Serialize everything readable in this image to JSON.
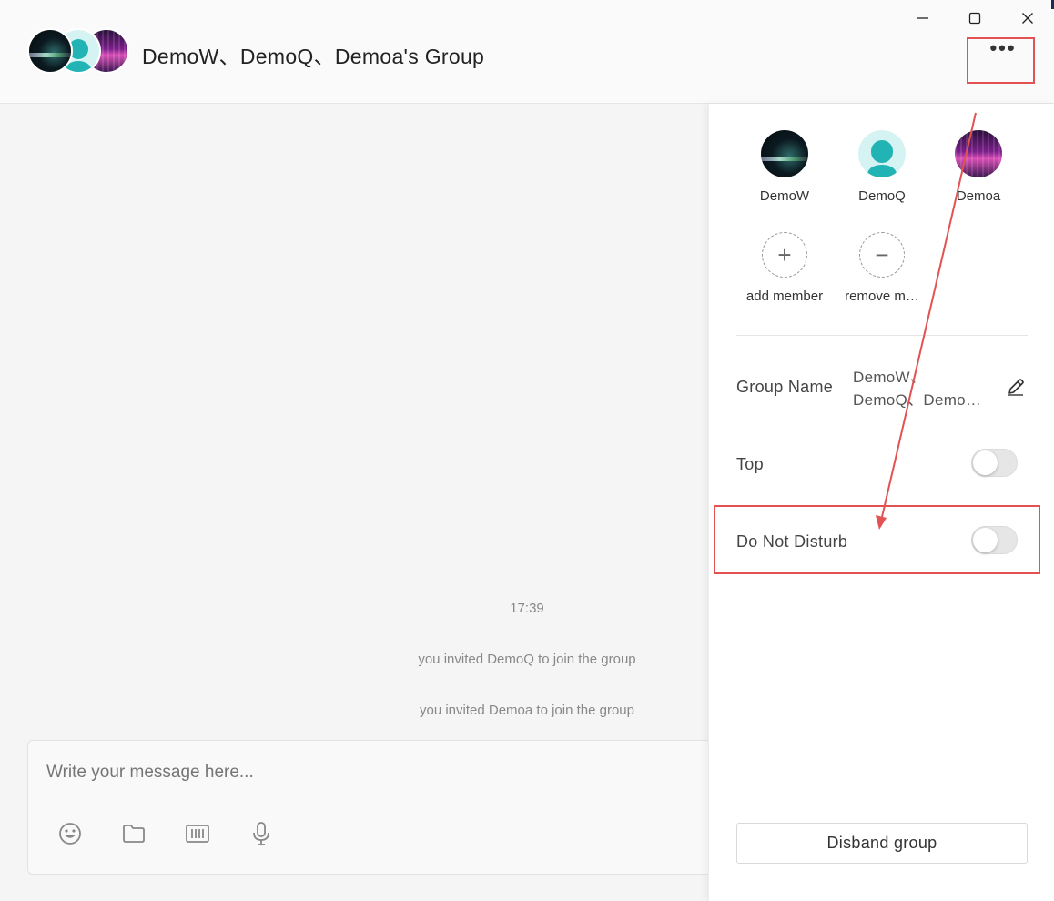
{
  "window": {
    "minimize": "—",
    "maximize": "☐",
    "close": "✕"
  },
  "header": {
    "title": "DemoW、DemoQ、Demoa's Group",
    "more_label": "•••",
    "avatars": [
      "DemoW-avatar",
      "DemoQ-avatar",
      "Demoa-avatar"
    ]
  },
  "chat": {
    "timestamp": "17:39",
    "system_messages": [
      "you invited DemoQ to join the group",
      "you invited Demoa to join the group"
    ]
  },
  "composer": {
    "placeholder": "Write your message here...",
    "tools": [
      "emoji-icon",
      "folder-icon",
      "screenshot-icon",
      "microphone-icon"
    ]
  },
  "panel": {
    "members": [
      {
        "name": "DemoW"
      },
      {
        "name": "DemoQ"
      },
      {
        "name": "Demoa"
      }
    ],
    "add_member": {
      "label": "add member",
      "symbol": "+"
    },
    "remove_member": {
      "label": "remove m…",
      "symbol": "−"
    },
    "group_name": {
      "label": "Group Name",
      "value": "DemoW、DemoQ、Demoa's Group"
    },
    "top": {
      "label": "Top",
      "on": false
    },
    "do_not_disturb": {
      "label": "Do Not Disturb",
      "on": false
    },
    "disband_label": "Disband group"
  },
  "annotations": {
    "highlight_color": "#e25252"
  }
}
